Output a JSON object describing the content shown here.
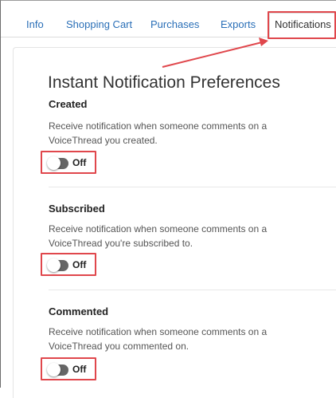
{
  "tabs": {
    "info": "Info",
    "shopping_cart": "Shopping Cart",
    "purchases": "Purchases",
    "exports": "Exports",
    "notifications": "Notifications"
  },
  "page_title": "Instant Notification Preferences",
  "sections": [
    {
      "title": "Created",
      "description": "Receive notification when someone comments on a VoiceThread you created.",
      "toggle_state": "Off"
    },
    {
      "title": "Subscribed",
      "description": "Receive notification when someone comments on a VoiceThread you're subscribed to.",
      "toggle_state": "Off"
    },
    {
      "title": "Commented",
      "description": "Receive notification when someone comments on a VoiceThread you commented on.",
      "toggle_state": "Off"
    }
  ],
  "colors": {
    "link": "#2a6fb7",
    "highlight": "#e0474c",
    "toggle_off": "#666666"
  }
}
